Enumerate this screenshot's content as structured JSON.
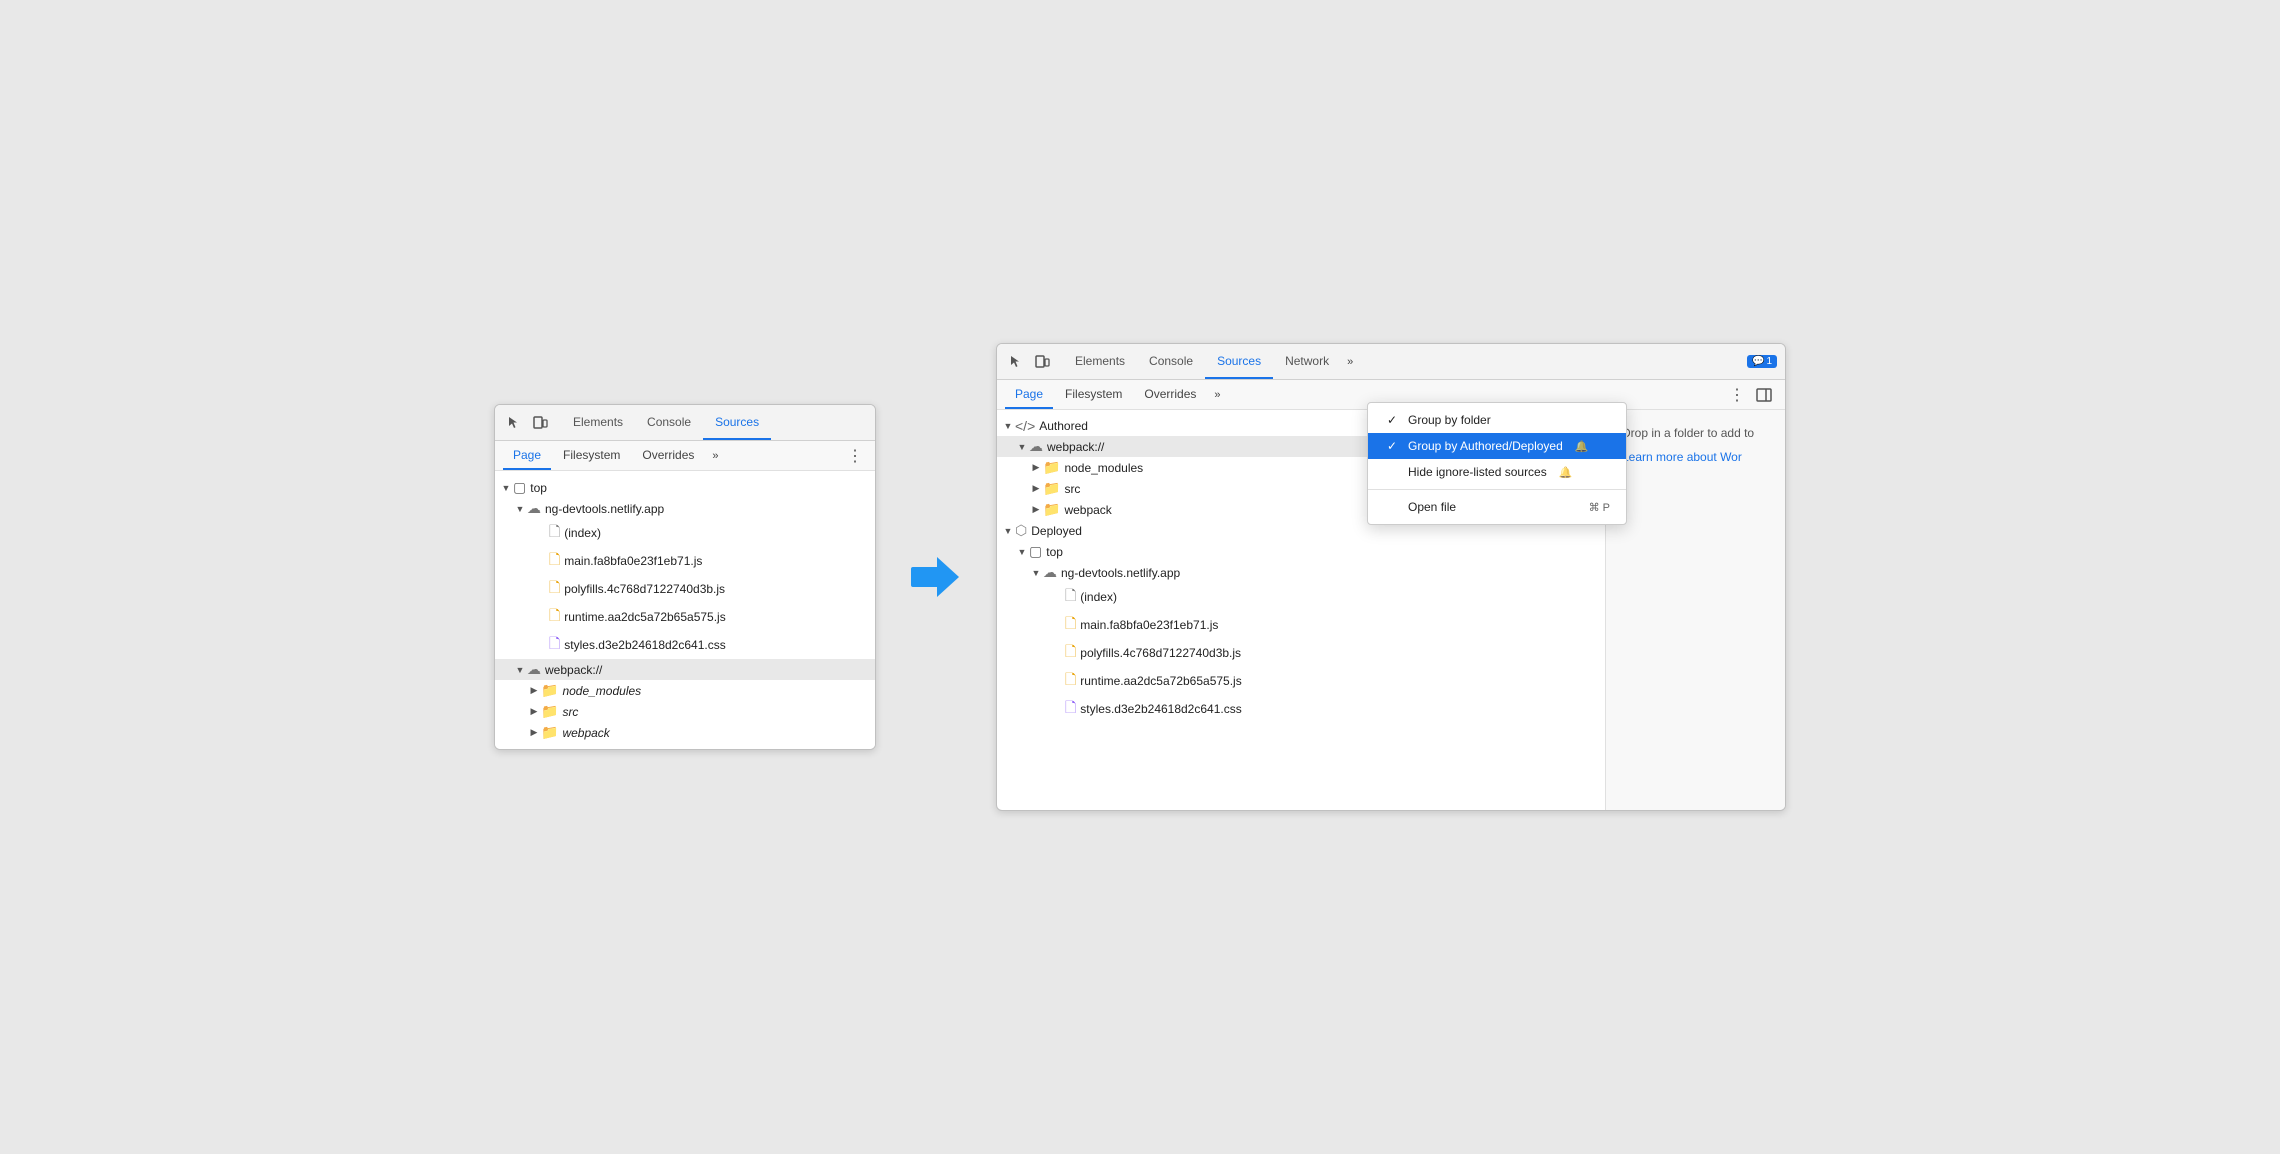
{
  "left_panel": {
    "toolbar": {
      "tabs": [
        "Elements",
        "Console",
        "Sources"
      ],
      "active_tab": "Sources"
    },
    "secondary_toolbar": {
      "tabs": [
        "Page",
        "Filesystem",
        "Overrides"
      ],
      "active_tab": "Page"
    },
    "tree": {
      "items": [
        {
          "level": 0,
          "type": "folder-expand",
          "icon": "square",
          "label": "top",
          "expanded": true
        },
        {
          "level": 1,
          "type": "folder-expand",
          "icon": "cloud",
          "label": "ng-devtools.netlify.app",
          "expanded": true
        },
        {
          "level": 2,
          "type": "file",
          "icon": "file-gray",
          "label": "(index)"
        },
        {
          "level": 2,
          "type": "file",
          "icon": "file-yellow",
          "label": "main.fa8bfa0e23f1eb71.js"
        },
        {
          "level": 2,
          "type": "file",
          "icon": "file-yellow",
          "label": "polyfills.4c768d7122740d3b.js"
        },
        {
          "level": 2,
          "type": "file",
          "icon": "file-yellow",
          "label": "runtime.aa2dc5a72b65a575.js"
        },
        {
          "level": 2,
          "type": "file",
          "icon": "file-purple",
          "label": "styles.d3e2b24618d2c641.css"
        },
        {
          "level": 1,
          "type": "folder-expand",
          "icon": "cloud",
          "label": "webpack://",
          "highlighted": true,
          "expanded": true
        },
        {
          "level": 2,
          "type": "folder-collapsed",
          "icon": "folder-orange",
          "label": "node_modules",
          "italic": true
        },
        {
          "level": 2,
          "type": "folder-collapsed",
          "icon": "folder-orange",
          "label": "src",
          "italic": true
        },
        {
          "level": 2,
          "type": "folder-collapsed",
          "icon": "folder-orange",
          "label": "webpack",
          "italic": true
        }
      ]
    }
  },
  "right_panel": {
    "toolbar": {
      "tabs": [
        "Elements",
        "Console",
        "Sources",
        "Network"
      ],
      "active_tab": "Sources",
      "notification": "1"
    },
    "secondary_toolbar": {
      "tabs": [
        "Page",
        "Filesystem",
        "Overrides"
      ],
      "active_tab": "Page"
    },
    "tree": {
      "items": [
        {
          "level": 0,
          "type": "folder-expand",
          "icon": "code",
          "label": "Authored",
          "expanded": true
        },
        {
          "level": 1,
          "type": "folder-expand",
          "icon": "cloud",
          "label": "webpack://",
          "highlighted": true,
          "expanded": true
        },
        {
          "level": 2,
          "type": "folder-collapsed",
          "icon": "folder-orange",
          "label": "node_modules"
        },
        {
          "level": 2,
          "type": "folder-collapsed",
          "icon": "folder-orange",
          "label": "src"
        },
        {
          "level": 2,
          "type": "folder-collapsed",
          "icon": "folder-orange",
          "label": "webpack"
        },
        {
          "level": 0,
          "type": "folder-expand",
          "icon": "cube",
          "label": "Deployed",
          "expanded": true
        },
        {
          "level": 1,
          "type": "folder-expand",
          "icon": "square",
          "label": "top",
          "expanded": true
        },
        {
          "level": 2,
          "type": "folder-expand",
          "icon": "cloud",
          "label": "ng-devtools.netlify.app",
          "expanded": true
        },
        {
          "level": 3,
          "type": "file",
          "icon": "file-gray",
          "label": "(index)"
        },
        {
          "level": 3,
          "type": "file",
          "icon": "file-yellow",
          "label": "main.fa8bfa0e23f1eb71.js"
        },
        {
          "level": 3,
          "type": "file",
          "icon": "file-yellow",
          "label": "polyfills.4c768d7122740d3b.js"
        },
        {
          "level": 3,
          "type": "file",
          "icon": "file-yellow",
          "label": "runtime.aa2dc5a72b65a575.js"
        },
        {
          "level": 3,
          "type": "file",
          "icon": "file-purple",
          "label": "styles.d3e2b24618d2c641.css"
        }
      ]
    },
    "context_menu": {
      "items": [
        {
          "id": "group-by-folder",
          "label": "Group by folder",
          "checked": true,
          "selected": false,
          "shortcut": ""
        },
        {
          "id": "group-by-authored",
          "label": "Group by Authored/Deployed",
          "checked": true,
          "selected": true,
          "has_warning": true,
          "shortcut": ""
        },
        {
          "id": "hide-ignore-listed",
          "label": "Hide ignore-listed sources",
          "checked": false,
          "selected": false,
          "has_warning": true,
          "shortcut": ""
        },
        {
          "separator": true
        },
        {
          "id": "open-file",
          "label": "Open file",
          "checked": false,
          "selected": false,
          "shortcut": "⌘ P"
        }
      ]
    },
    "filesystem_panel": {
      "drop_text": "Drop in a folder to add to",
      "learn_more_text": "Learn more about Wor"
    }
  }
}
